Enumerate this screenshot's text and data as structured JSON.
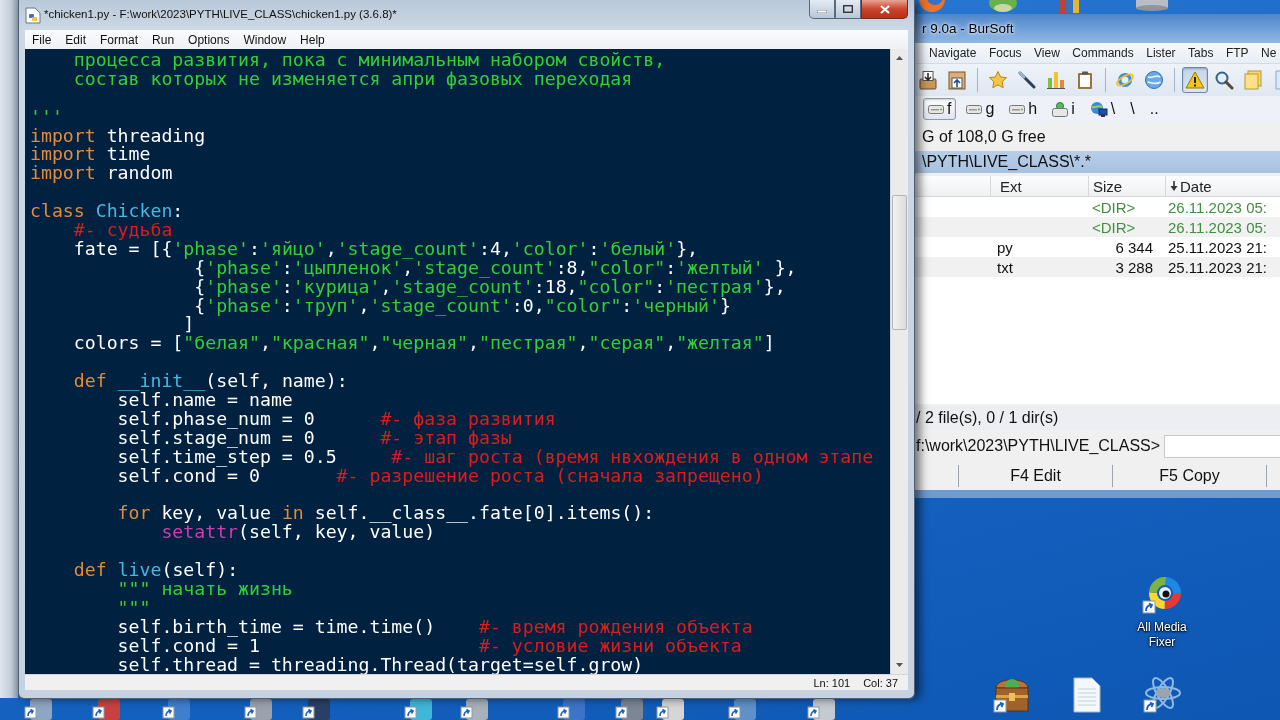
{
  "idle_window": {
    "title": "*chicken1.py - F:\\work\\2023\\PYTH\\LIVE_CLASS\\chicken1.py (3.6.8)*",
    "menu": [
      "File",
      "Edit",
      "Format",
      "Run",
      "Options",
      "Window",
      "Help"
    ],
    "code_lines": [
      {
        "kind": "code",
        "tokens": [
          {
            "kind": "string",
            "text": "    процесса развития, пока с минимальным набором свойств,"
          }
        ]
      },
      {
        "kind": "code",
        "tokens": [
          {
            "kind": "string",
            "text": "    состав которых не изменяется апри фазовых переходая"
          }
        ]
      },
      {
        "kind": "blank"
      },
      {
        "kind": "code",
        "tokens": [
          {
            "kind": "string",
            "text": "'''"
          }
        ]
      },
      {
        "kind": "code",
        "tokens": [
          {
            "kind": "keyword",
            "text": "import"
          },
          {
            "kind": "plain",
            "text": " threading"
          }
        ]
      },
      {
        "kind": "code",
        "tokens": [
          {
            "kind": "keyword",
            "text": "import"
          },
          {
            "kind": "plain",
            "text": " time"
          }
        ]
      },
      {
        "kind": "code",
        "tokens": [
          {
            "kind": "keyword",
            "text": "import"
          },
          {
            "kind": "plain",
            "text": " random"
          }
        ]
      },
      {
        "kind": "blank"
      },
      {
        "kind": "code",
        "tokens": [
          {
            "kind": "keyword",
            "text": "class "
          },
          {
            "kind": "definition",
            "text": "Chicken"
          },
          {
            "kind": "plain",
            "text": ":"
          }
        ]
      },
      {
        "kind": "code",
        "tokens": [
          {
            "kind": "comment",
            "text": "    #- судьба"
          }
        ]
      },
      {
        "kind": "code",
        "tokens": [
          {
            "kind": "plain",
            "text": "    fate = [{"
          },
          {
            "kind": "string",
            "text": "'phase'"
          },
          {
            "kind": "plain",
            "text": ":"
          },
          {
            "kind": "string",
            "text": "'яйцо'"
          },
          {
            "kind": "plain",
            "text": ","
          },
          {
            "kind": "string",
            "text": "'stage_count'"
          },
          {
            "kind": "plain",
            "text": ":4,"
          },
          {
            "kind": "string",
            "text": "'color'"
          },
          {
            "kind": "plain",
            "text": ":"
          },
          {
            "kind": "string",
            "text": "'белый'"
          },
          {
            "kind": "plain",
            "text": "},"
          }
        ]
      },
      {
        "kind": "code",
        "tokens": [
          {
            "kind": "plain",
            "text": "               {"
          },
          {
            "kind": "string",
            "text": "'phase'"
          },
          {
            "kind": "plain",
            "text": ":"
          },
          {
            "kind": "string",
            "text": "'цыпленок'"
          },
          {
            "kind": "plain",
            "text": ","
          },
          {
            "kind": "string",
            "text": "'stage_count'"
          },
          {
            "kind": "plain",
            "text": ":8,"
          },
          {
            "kind": "string",
            "text": "\"color\""
          },
          {
            "kind": "plain",
            "text": ":"
          },
          {
            "kind": "string",
            "text": "'желтый'"
          },
          {
            "kind": "plain",
            "text": " },"
          }
        ]
      },
      {
        "kind": "code",
        "tokens": [
          {
            "kind": "plain",
            "text": "               {"
          },
          {
            "kind": "string",
            "text": "'phase'"
          },
          {
            "kind": "plain",
            "text": ":"
          },
          {
            "kind": "string",
            "text": "'курица'"
          },
          {
            "kind": "plain",
            "text": ","
          },
          {
            "kind": "string",
            "text": "'stage_count'"
          },
          {
            "kind": "plain",
            "text": ":18,"
          },
          {
            "kind": "string",
            "text": "\"color\""
          },
          {
            "kind": "plain",
            "text": ":"
          },
          {
            "kind": "string",
            "text": "'пестрая'"
          },
          {
            "kind": "plain",
            "text": "},"
          }
        ]
      },
      {
        "kind": "code",
        "tokens": [
          {
            "kind": "plain",
            "text": "               {"
          },
          {
            "kind": "string",
            "text": "'phase'"
          },
          {
            "kind": "plain",
            "text": ":"
          },
          {
            "kind": "string",
            "text": "'труп'"
          },
          {
            "kind": "plain",
            "text": ","
          },
          {
            "kind": "string",
            "text": "'stage_count'"
          },
          {
            "kind": "plain",
            "text": ":0,"
          },
          {
            "kind": "string",
            "text": "\"color\""
          },
          {
            "kind": "plain",
            "text": ":"
          },
          {
            "kind": "string",
            "text": "'черный'"
          },
          {
            "kind": "plain",
            "text": "}"
          }
        ]
      },
      {
        "kind": "code",
        "tokens": [
          {
            "kind": "plain",
            "text": "              ]"
          }
        ]
      },
      {
        "kind": "code",
        "tokens": [
          {
            "kind": "plain",
            "text": "    colors = ["
          },
          {
            "kind": "string",
            "text": "\"белая\""
          },
          {
            "kind": "plain",
            "text": ","
          },
          {
            "kind": "string",
            "text": "\"красная\""
          },
          {
            "kind": "plain",
            "text": ","
          },
          {
            "kind": "string",
            "text": "\"черная\""
          },
          {
            "kind": "plain",
            "text": ","
          },
          {
            "kind": "string",
            "text": "\"пестрая\""
          },
          {
            "kind": "plain",
            "text": ","
          },
          {
            "kind": "string",
            "text": "\"серая\""
          },
          {
            "kind": "plain",
            "text": ","
          },
          {
            "kind": "string",
            "text": "\"желтая\""
          },
          {
            "kind": "plain",
            "text": "]"
          }
        ]
      },
      {
        "kind": "blank"
      },
      {
        "kind": "code",
        "tokens": [
          {
            "kind": "keyword",
            "text": "    def "
          },
          {
            "kind": "definition",
            "text": "__init__"
          },
          {
            "kind": "plain",
            "text": "(self, name):"
          }
        ]
      },
      {
        "kind": "code",
        "tokens": [
          {
            "kind": "plain",
            "text": "        self.name = name"
          }
        ]
      },
      {
        "kind": "code",
        "tokens": [
          {
            "kind": "plain",
            "text": "        self.phase_num = 0      "
          },
          {
            "kind": "comment",
            "text": "#- фаза развития"
          }
        ]
      },
      {
        "kind": "code",
        "tokens": [
          {
            "kind": "plain",
            "text": "        self.stage_num = 0      "
          },
          {
            "kind": "comment",
            "text": "#- этап фазы"
          }
        ]
      },
      {
        "kind": "code",
        "tokens": [
          {
            "kind": "plain",
            "text": "        self.time_step = 0.5     "
          },
          {
            "kind": "comment",
            "text": "#- шаг роста (время нвхождения в одном этапе"
          }
        ]
      },
      {
        "kind": "code",
        "tokens": [
          {
            "kind": "plain",
            "text": "        self.cond = 0       "
          },
          {
            "kind": "comment",
            "text": "#- разрешение роста (сначала запрещено)"
          }
        ]
      },
      {
        "kind": "blank"
      },
      {
        "kind": "code",
        "tokens": [
          {
            "kind": "keyword",
            "text": "        for"
          },
          {
            "kind": "plain",
            "text": " key, value "
          },
          {
            "kind": "keyword",
            "text": "in"
          },
          {
            "kind": "plain",
            "text": " self.__class__.fate[0].items():"
          }
        ]
      },
      {
        "kind": "code",
        "tokens": [
          {
            "kind": "builtin",
            "text": "            setattr"
          },
          {
            "kind": "plain",
            "text": "(self, key, value)"
          }
        ]
      },
      {
        "kind": "blank"
      },
      {
        "kind": "code",
        "tokens": [
          {
            "kind": "keyword",
            "text": "    def "
          },
          {
            "kind": "definition",
            "text": "live"
          },
          {
            "kind": "plain",
            "text": "(self):"
          }
        ]
      },
      {
        "kind": "code",
        "tokens": [
          {
            "kind": "string",
            "text": "        \"\"\" начать жизнь"
          }
        ]
      },
      {
        "kind": "code",
        "tokens": [
          {
            "kind": "string",
            "text": "        \"\"\""
          }
        ]
      },
      {
        "kind": "code",
        "tokens": [
          {
            "kind": "plain",
            "text": "        self.birth_time = time.time()    "
          },
          {
            "kind": "comment",
            "text": "#- время рождения объекта"
          }
        ]
      },
      {
        "kind": "code",
        "tokens": [
          {
            "kind": "plain",
            "text": "        self.cond = 1                    "
          },
          {
            "kind": "comment",
            "text": "#- условие жизни объекта"
          }
        ]
      },
      {
        "kind": "code",
        "tokens": [
          {
            "kind": "plain",
            "text": "        self.thread = threading.Thread(target=self.grow)"
          }
        ]
      }
    ],
    "status_bar": {
      "line": "Ln: 101",
      "column": "Col: 37"
    }
  },
  "file_manager": {
    "title": "r 9.0a - BurSoft",
    "menu": [
      "Navigate",
      "Focus",
      "View",
      "Commands",
      "Lister",
      "Tabs",
      "FTP",
      "Ne"
    ],
    "toolbar": [
      [
        {
          "kind": "download",
          "pressed": false
        },
        {
          "kind": "upload",
          "pressed": false
        }
      ],
      [
        {
          "kind": "star",
          "pressed": false
        },
        {
          "kind": "wand",
          "pressed": false
        },
        {
          "kind": "chart",
          "pressed": false
        },
        {
          "kind": "clipboard",
          "pressed": false
        }
      ],
      [
        {
          "kind": "browser",
          "pressed": false
        },
        {
          "kind": "globe",
          "pressed": false
        }
      ],
      [
        {
          "kind": "warning",
          "pressed": true
        },
        {
          "kind": "search",
          "pressed": false
        },
        {
          "kind": "notes",
          "pressed": false
        },
        {
          "kind": "page",
          "pressed": false
        }
      ]
    ],
    "drives": [
      {
        "kind": "disk",
        "label": "f",
        "selected": true
      },
      {
        "kind": "disk",
        "label": "g",
        "selected": false
      },
      {
        "kind": "disk",
        "label": "h",
        "selected": false
      },
      {
        "kind": "network-disk",
        "label": "i",
        "selected": false
      },
      {
        "kind": "network",
        "label": "\\",
        "selected": false
      },
      {
        "kind": "plain",
        "label": "\\",
        "selected": false
      },
      {
        "kind": "plain",
        "label": "..",
        "selected": false
      }
    ],
    "free_space": "G of 108,0 G free",
    "path": "\\PYTH\\LIVE_CLASS\\*.*",
    "columns": [
      {
        "label": "Ext",
        "sorted": false
      },
      {
        "label": "Size",
        "sorted": false
      },
      {
        "label": "Date",
        "sorted": true
      }
    ],
    "rows": [
      {
        "kind": "dir",
        "size": "<DIR>",
        "date": "26.11.2023 05:"
      },
      {
        "kind": "dir",
        "size": "<DIR>",
        "date": "26.11.2023 05:"
      },
      {
        "kind": "file",
        "ext": "py",
        "size": "6 344",
        "date": "25.11.2023 21:"
      },
      {
        "kind": "file",
        "ext": "txt",
        "size": "3 288",
        "date": "25.11.2023 21:"
      }
    ],
    "status": "/ 2 file(s), 0 / 1 dir(s)",
    "command_prompt": "f:\\work\\2023\\PYTH\\LIVE_CLASS>",
    "function_keys": [
      "F4 Edit",
      "F5 Copy"
    ]
  },
  "desktop_icons": [
    {
      "kind": "media-fixer",
      "label": "All Media Fixer",
      "shortcut": true
    },
    {
      "kind": "chest",
      "shortcut": true
    },
    {
      "kind": "document",
      "shortcut": false
    },
    {
      "kind": "atom",
      "shortcut": true
    }
  ]
}
